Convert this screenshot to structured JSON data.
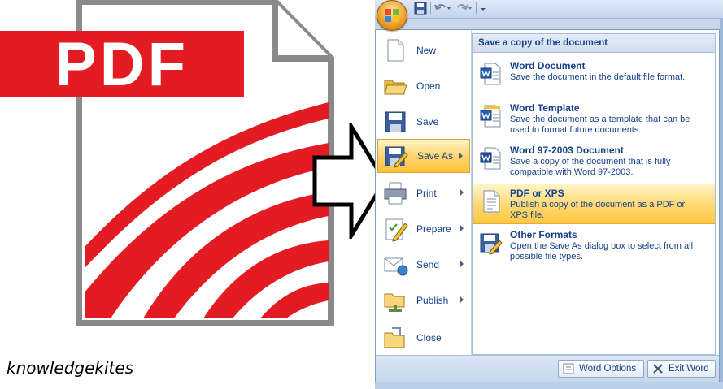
{
  "pdf_logo": {
    "text": "PDF",
    "color": "#e31b23"
  },
  "watermark": "knowledgekites",
  "office": {
    "colors": {
      "accent_text": "#15428b",
      "highlight": "#ffd36b",
      "border": "#7f9db9"
    },
    "left_menu": [
      {
        "label": "New",
        "icon": "new-document-icon",
        "submenu": false,
        "active": false
      },
      {
        "label": "Open",
        "icon": "open-folder-icon",
        "submenu": false,
        "active": false
      },
      {
        "label": "Save",
        "icon": "save-disk-icon",
        "submenu": false,
        "active": false
      },
      {
        "label": "Save As",
        "icon": "save-as-icon",
        "submenu": true,
        "active": true
      },
      {
        "label": "Print",
        "icon": "printer-icon",
        "submenu": true,
        "active": false
      },
      {
        "label": "Prepare",
        "icon": "prepare-icon",
        "submenu": true,
        "active": false
      },
      {
        "label": "Send",
        "icon": "send-icon",
        "submenu": true,
        "active": false
      },
      {
        "label": "Publish",
        "icon": "publish-icon",
        "submenu": true,
        "active": false
      },
      {
        "label": "Close",
        "icon": "close-folder-icon",
        "submenu": false,
        "active": false
      }
    ],
    "submenu": {
      "header": "Save a copy of the document",
      "items": [
        {
          "title": "Word Document",
          "desc": "Save the document in the default file format.",
          "icon": "word-document-icon",
          "active": false
        },
        {
          "title": "Word Template",
          "desc": "Save the document as a template that can be used to format future documents.",
          "icon": "word-template-icon",
          "active": false
        },
        {
          "title": "Word 97-2003 Document",
          "desc": "Save a copy of the document that is fully compatible with Word 97-2003.",
          "icon": "word-97-icon",
          "active": false
        },
        {
          "title": "PDF or XPS",
          "desc": "Publish a copy of the document as a PDF or XPS file.",
          "icon": "pdf-xps-icon",
          "active": true
        },
        {
          "title": "Other Formats",
          "desc": "Open the Save As dialog box to select from all possible file types.",
          "icon": "other-formats-icon",
          "active": false
        }
      ]
    },
    "bottom_buttons": {
      "options": "Word Options",
      "exit": "Exit Word"
    }
  }
}
